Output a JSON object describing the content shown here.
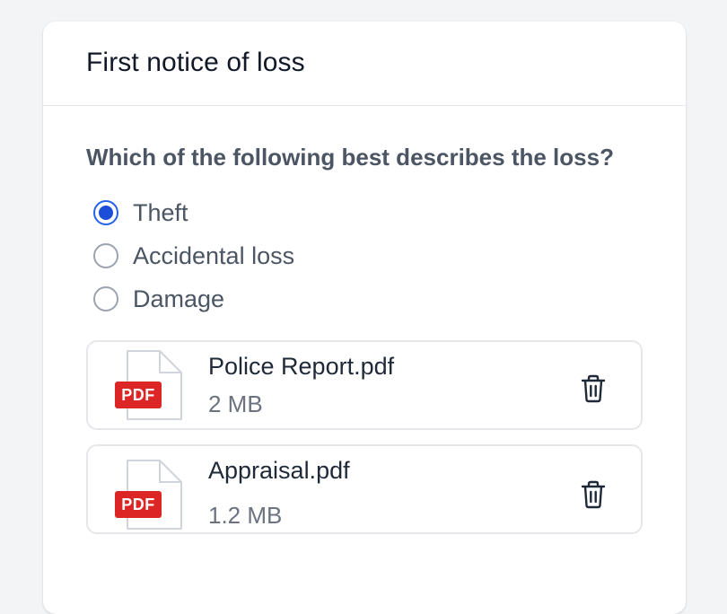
{
  "card": {
    "title": "First notice of loss"
  },
  "question": {
    "text": "Which of the following best describes the loss?",
    "options": [
      {
        "label": "Theft",
        "selected": true
      },
      {
        "label": "Accidental loss",
        "selected": false
      },
      {
        "label": "Damage",
        "selected": false
      }
    ]
  },
  "files": [
    {
      "badge": "PDF",
      "name": "Police Report.pdf",
      "size": "2 MB",
      "icon": "pdf-file-icon",
      "action_icon": "trash-icon"
    },
    {
      "badge": "PDF",
      "name": "Appraisal.pdf",
      "size": "1.2 MB",
      "icon": "pdf-file-icon",
      "action_icon": "trash-icon"
    }
  ],
  "colors": {
    "accent": "#1d4ed8",
    "pdf_badge": "#dc2626",
    "text_primary": "#111827",
    "text_secondary": "#4b5563",
    "border": "#e5e7eb"
  }
}
